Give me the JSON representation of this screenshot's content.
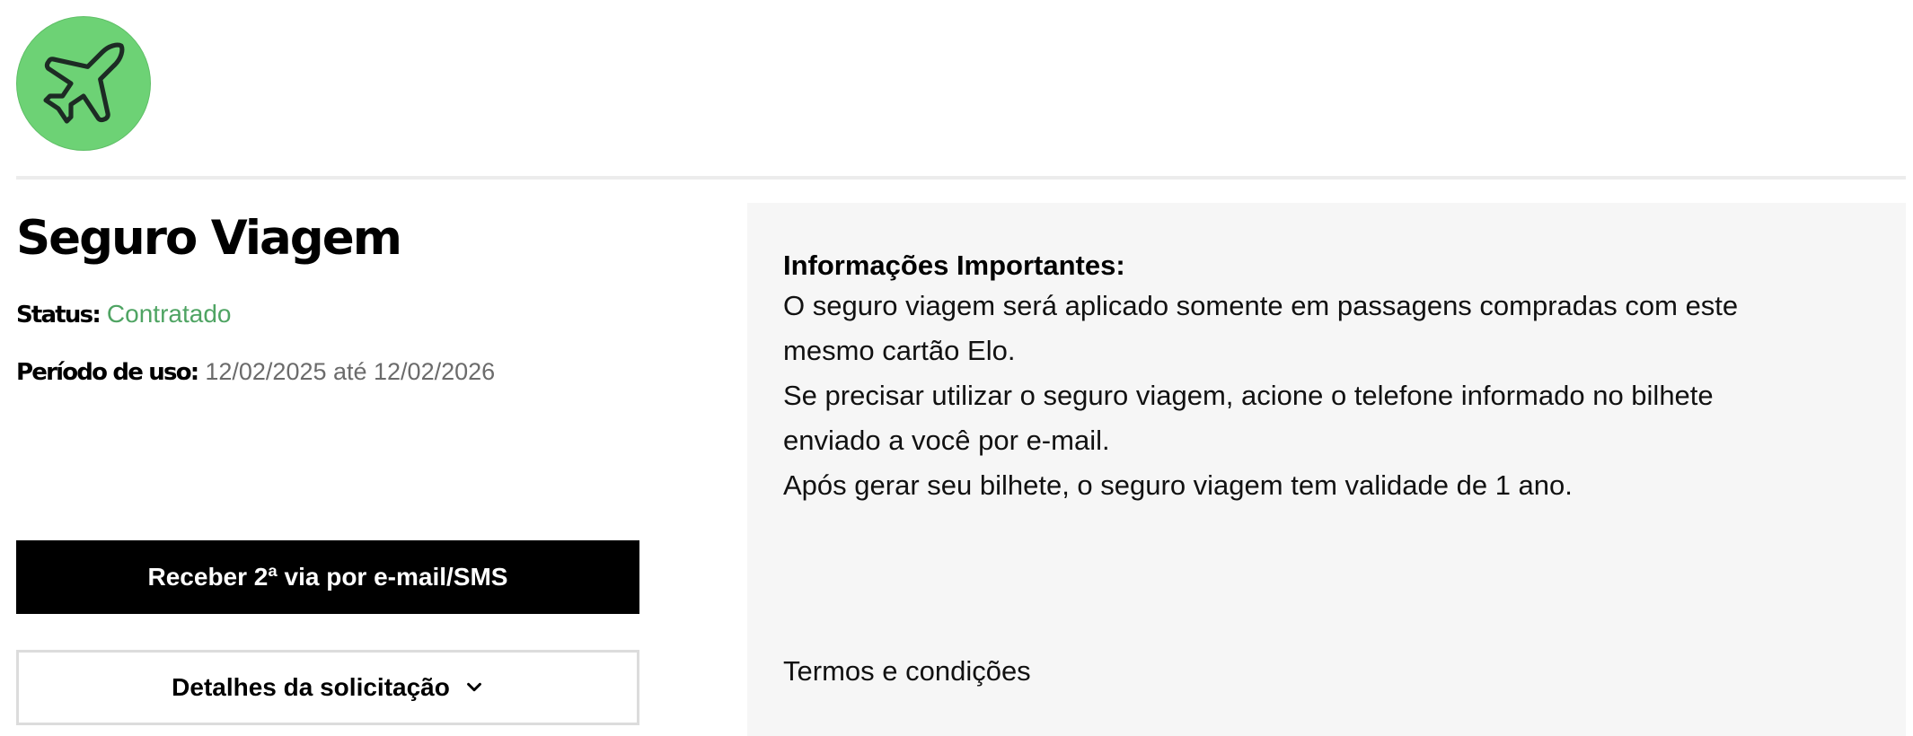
{
  "header": {
    "icon": "airplane-icon",
    "icon_bg_color": "#6dd275"
  },
  "product": {
    "title": "Seguro Viagem",
    "status_label": "Status:",
    "status_value": "Contratado",
    "status_color": "#4fa463",
    "period_label": "Período de uso:",
    "period_value": "12/02/2025 até 12/02/2026"
  },
  "actions": {
    "resend_label": "Receber 2ª via por e-mail/SMS",
    "details_label": "Detalhes da solicitação",
    "details_icon": "chevron-down-icon"
  },
  "info": {
    "heading": "Informações Importantes:",
    "lines": [
      "O seguro viagem será aplicado somente em passagens compradas com este",
      "mesmo cartão Elo.",
      "Se precisar utilizar o seguro viagem, acione o telefone informado no bilhete",
      "enviado a você por e-mail.",
      "Após gerar seu bilhete, o seguro viagem tem validade de 1 ano."
    ],
    "terms_label": "Termos e condições"
  }
}
